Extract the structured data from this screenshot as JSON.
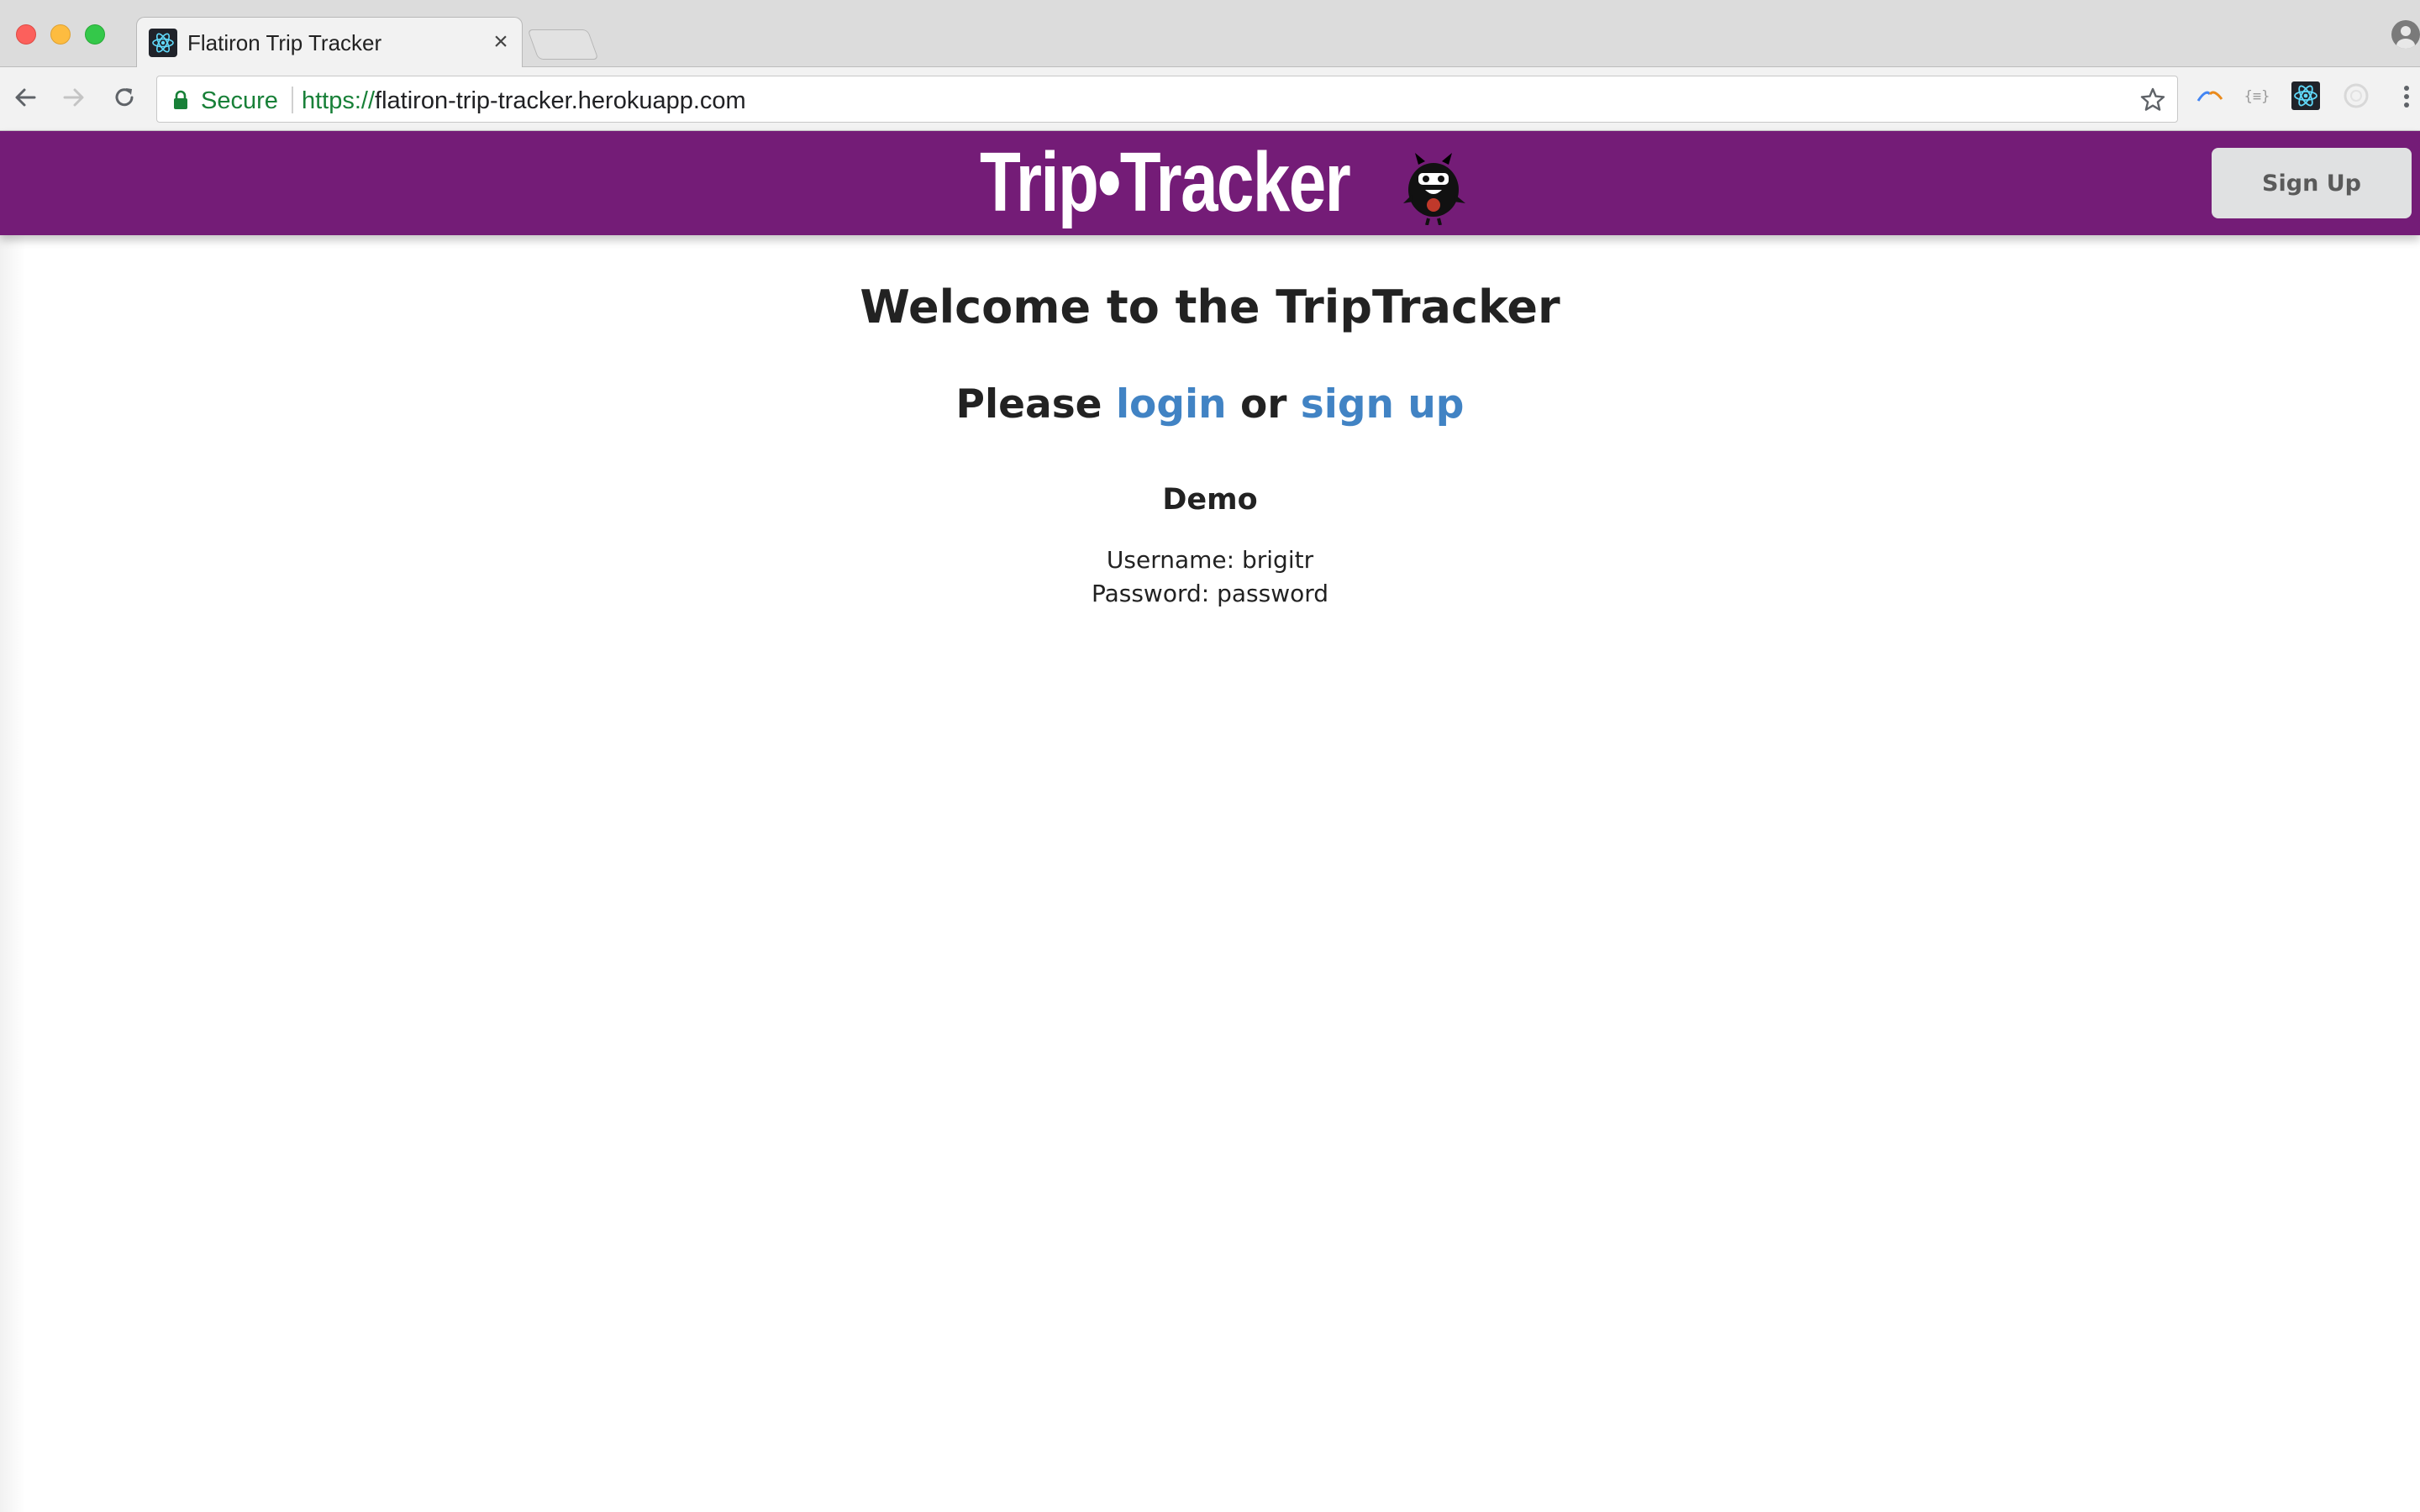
{
  "browser": {
    "tab": {
      "title": "Flatiron Trip Tracker",
      "favicon": "react-atom-icon",
      "close_glyph": "×"
    },
    "address_bar": {
      "security_label": "Secure",
      "url_scheme": "https://",
      "url_rest": "flatiron-trip-tracker.herokuapp.com"
    },
    "extensions": [
      "extension-arc-icon",
      "extension-braces-icon",
      "react-devtools-icon",
      "extension-circle-icon"
    ]
  },
  "app": {
    "brand": {
      "logo_text": "Trip•Tracker",
      "mascot": "mascot-icon",
      "header_color": "#741c77"
    },
    "header": {
      "signup_label": "Sign Up"
    },
    "main": {
      "welcome_title": "Welcome to the TripTracker",
      "prompt": {
        "prefix": "Please",
        "login_link": "login",
        "connector": "or",
        "signup_link": "sign up"
      },
      "demo": {
        "title": "Demo",
        "username_line": "Username: brigitr",
        "password_line": "Password: password"
      }
    },
    "colors": {
      "link": "#4183c4",
      "secure": "#188038"
    }
  }
}
